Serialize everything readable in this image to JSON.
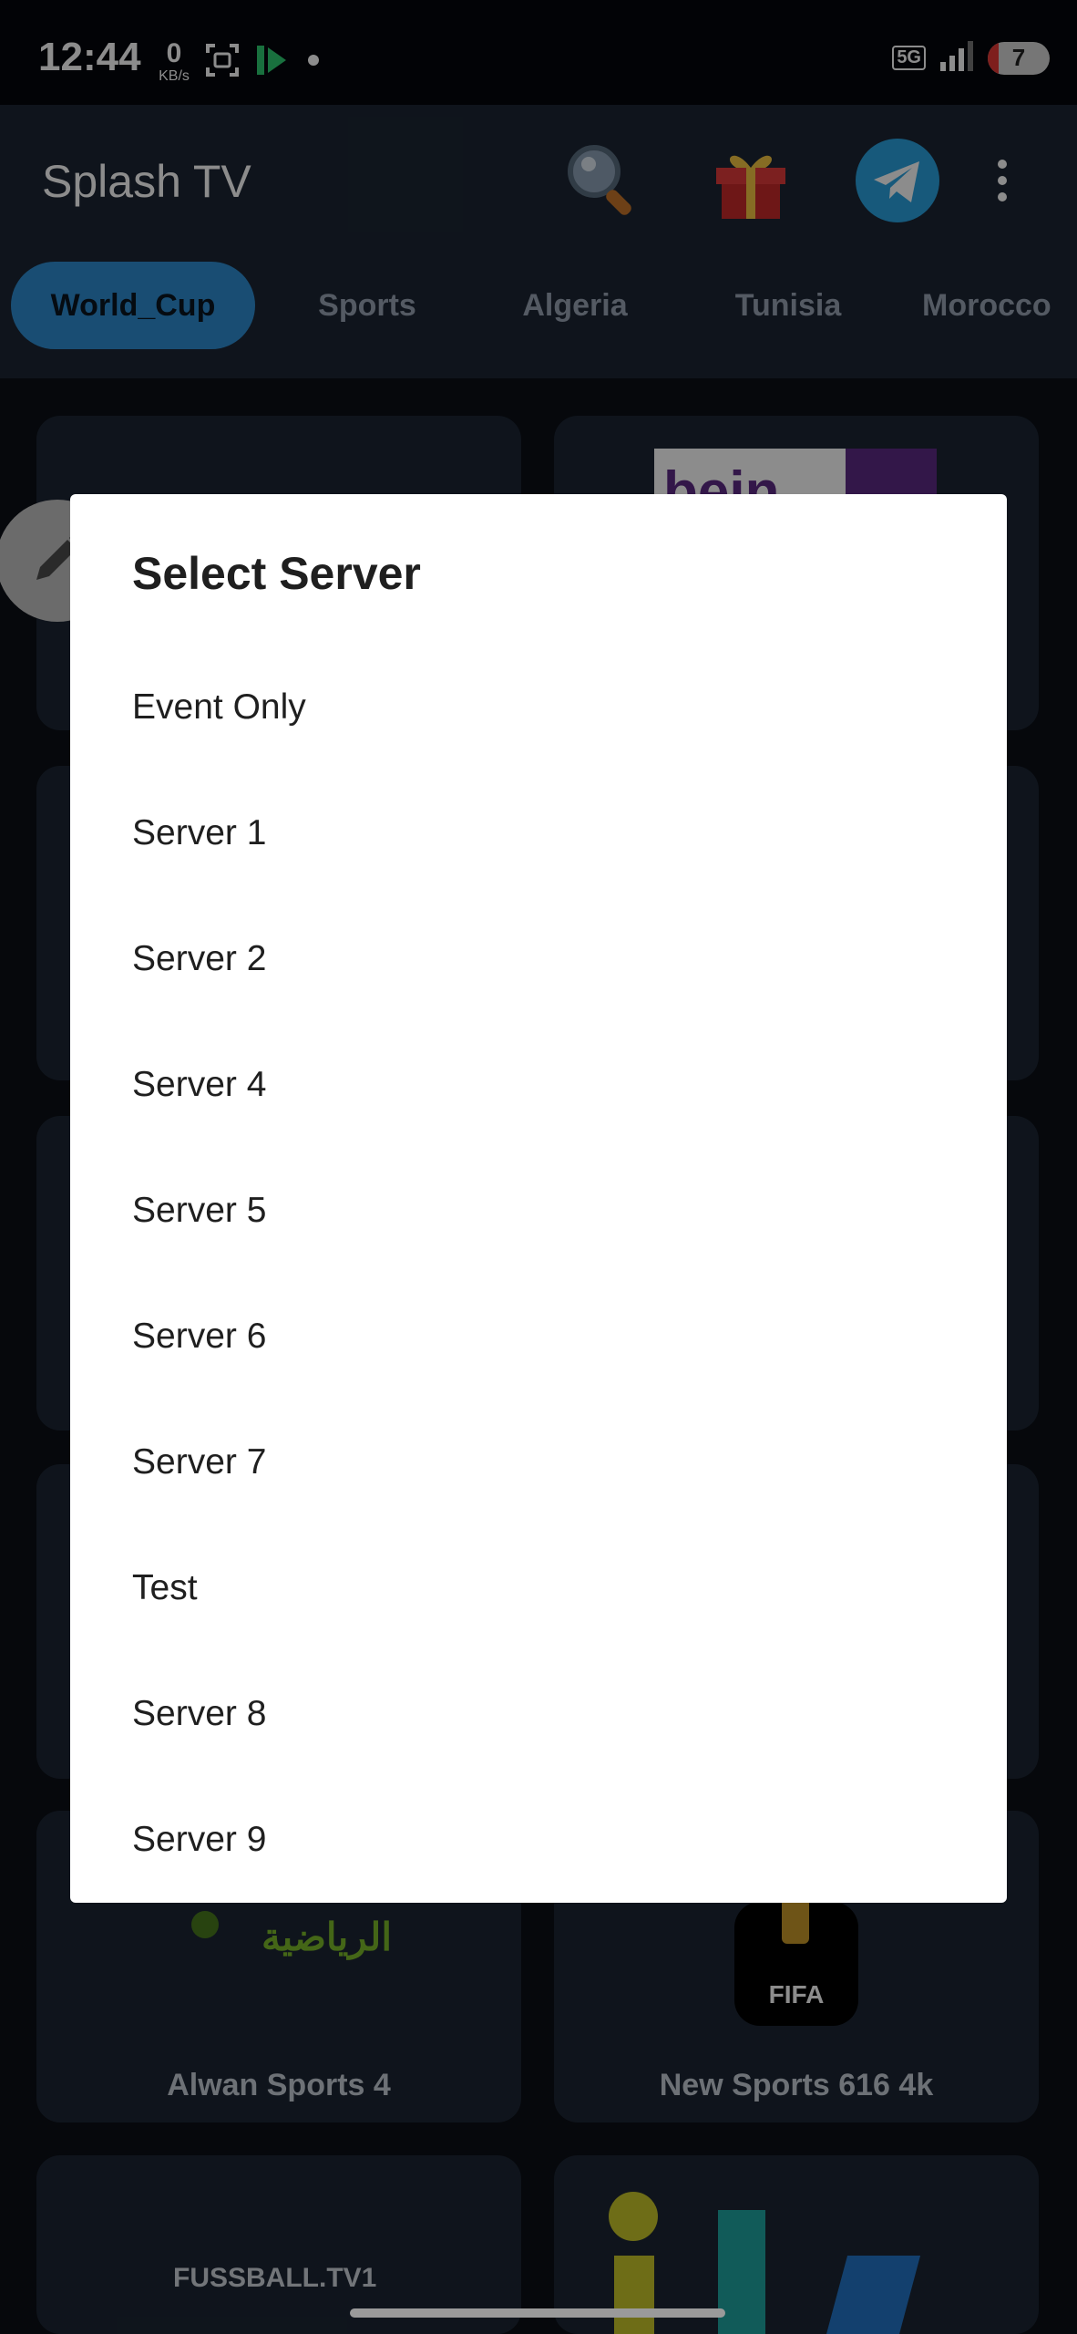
{
  "status_bar": {
    "time": "12:44",
    "net_speed_value": "0",
    "net_speed_unit": "KB/s",
    "network": "5G",
    "battery": "7"
  },
  "app_bar": {
    "title": "Splash TV",
    "icons": [
      "search-icon",
      "gift-icon",
      "telegram-icon",
      "more-vert-icon"
    ]
  },
  "tabs": [
    {
      "label": "World_Cup",
      "active": true
    },
    {
      "label": "Sports",
      "active": false
    },
    {
      "label": "Algeria",
      "active": false
    },
    {
      "label": "Tunisia",
      "active": false
    },
    {
      "label": "Morocco",
      "active": false
    }
  ],
  "cards": [
    {
      "label": "Alwan Sports 4",
      "logo_text": "الرياضية"
    },
    {
      "label": "New Sports 616 4k",
      "logo_text": "FIFA"
    },
    {
      "logo_text": "FUSSBALL.TV1"
    },
    {
      "logo_text": "itv"
    },
    {
      "logo_text": "bein"
    }
  ],
  "dialog": {
    "title": "Select Server",
    "items": [
      "Event Only",
      "Server 1",
      "Server 2",
      "Server 4",
      "Server 5",
      "Server 6",
      "Server 7",
      "Test",
      "Server 8",
      "Server 9"
    ]
  },
  "colors": {
    "accent": "#2f8dd1",
    "background": "#0b0f17",
    "surface": "#1c2633",
    "dialog": "#ffffff"
  }
}
